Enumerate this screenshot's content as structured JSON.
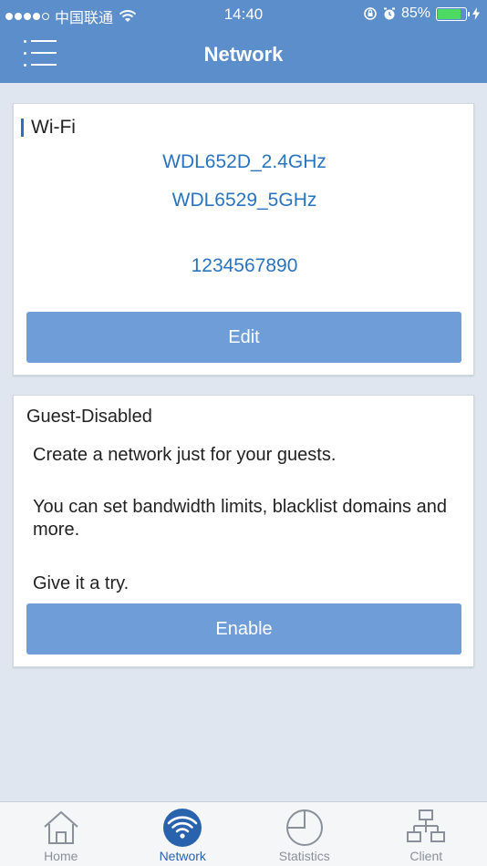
{
  "status_bar": {
    "carrier": "中国联通",
    "time": "14:40",
    "battery": "85%",
    "battery_level": 0.85,
    "signal_bars_filled": 4,
    "signal_bars_total": 5
  },
  "header": {
    "title": "Network",
    "menu_icon": "list-menu-icon"
  },
  "wifi": {
    "title": "Wi-Fi",
    "ssid_24": "WDL652D_2.4GHz",
    "ssid_5": "WDL6529_5GHz",
    "password": "1234567890",
    "edit_label": "Edit"
  },
  "guest": {
    "title": "Guest-Disabled",
    "line1": "Create a network just for your guests.",
    "line2": "You can set bandwidth limits, blacklist domains and more.",
    "line3": "Give it a try.",
    "enable_label": "Enable"
  },
  "tabs": [
    {
      "label": "Home",
      "icon": "home-icon",
      "active": false
    },
    {
      "label": "Network",
      "icon": "wifi-icon",
      "active": true
    },
    {
      "label": "Statistics",
      "icon": "pie-chart-icon",
      "active": false
    },
    {
      "label": "Client",
      "icon": "network-tree-icon",
      "active": false
    }
  ],
  "colors": {
    "header": "#5b8ecb",
    "accent_text": "#2a73bd",
    "button": "#6f9dd8",
    "active_tab": "#2a63ad",
    "battery": "#4cd964"
  }
}
